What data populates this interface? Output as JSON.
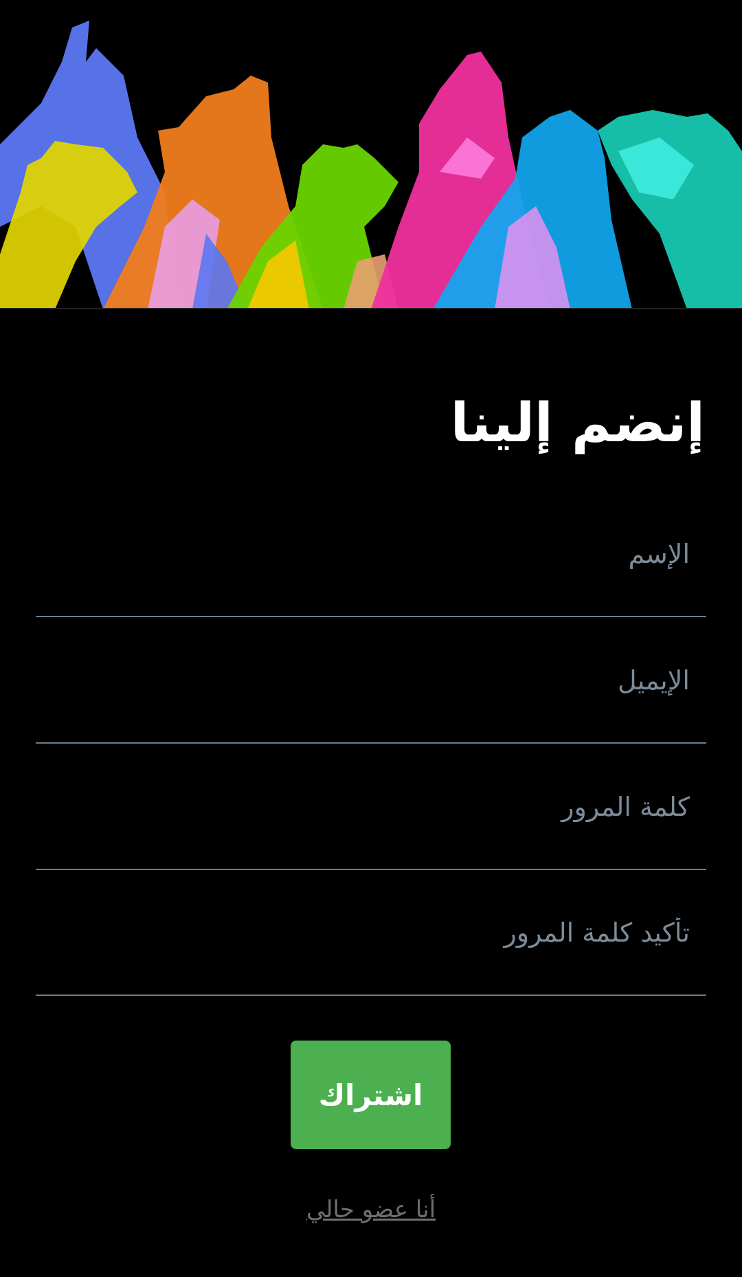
{
  "hero": {
    "image_name": "colorful-raised-hands-banner",
    "colors": [
      "#5b78f2",
      "#e8e000",
      "#f07c1c",
      "#e8a0f0",
      "#6ad400",
      "#f0309e",
      "#10a8f0",
      "#18c8b0"
    ]
  },
  "page": {
    "title": "إنضم إلينا"
  },
  "form": {
    "name_placeholder": "الإسم",
    "email_placeholder": "الإيميل",
    "password_placeholder": "كلمة المرور",
    "confirm_password_placeholder": "تأكيد كلمة المرور",
    "submit_label": "اشتراك",
    "member_link": "أنا عضو حالي"
  },
  "colors": {
    "background": "#000000",
    "accent": "#4caf50",
    "field_line": "#6b7d8c",
    "placeholder": "#7b8b99"
  }
}
